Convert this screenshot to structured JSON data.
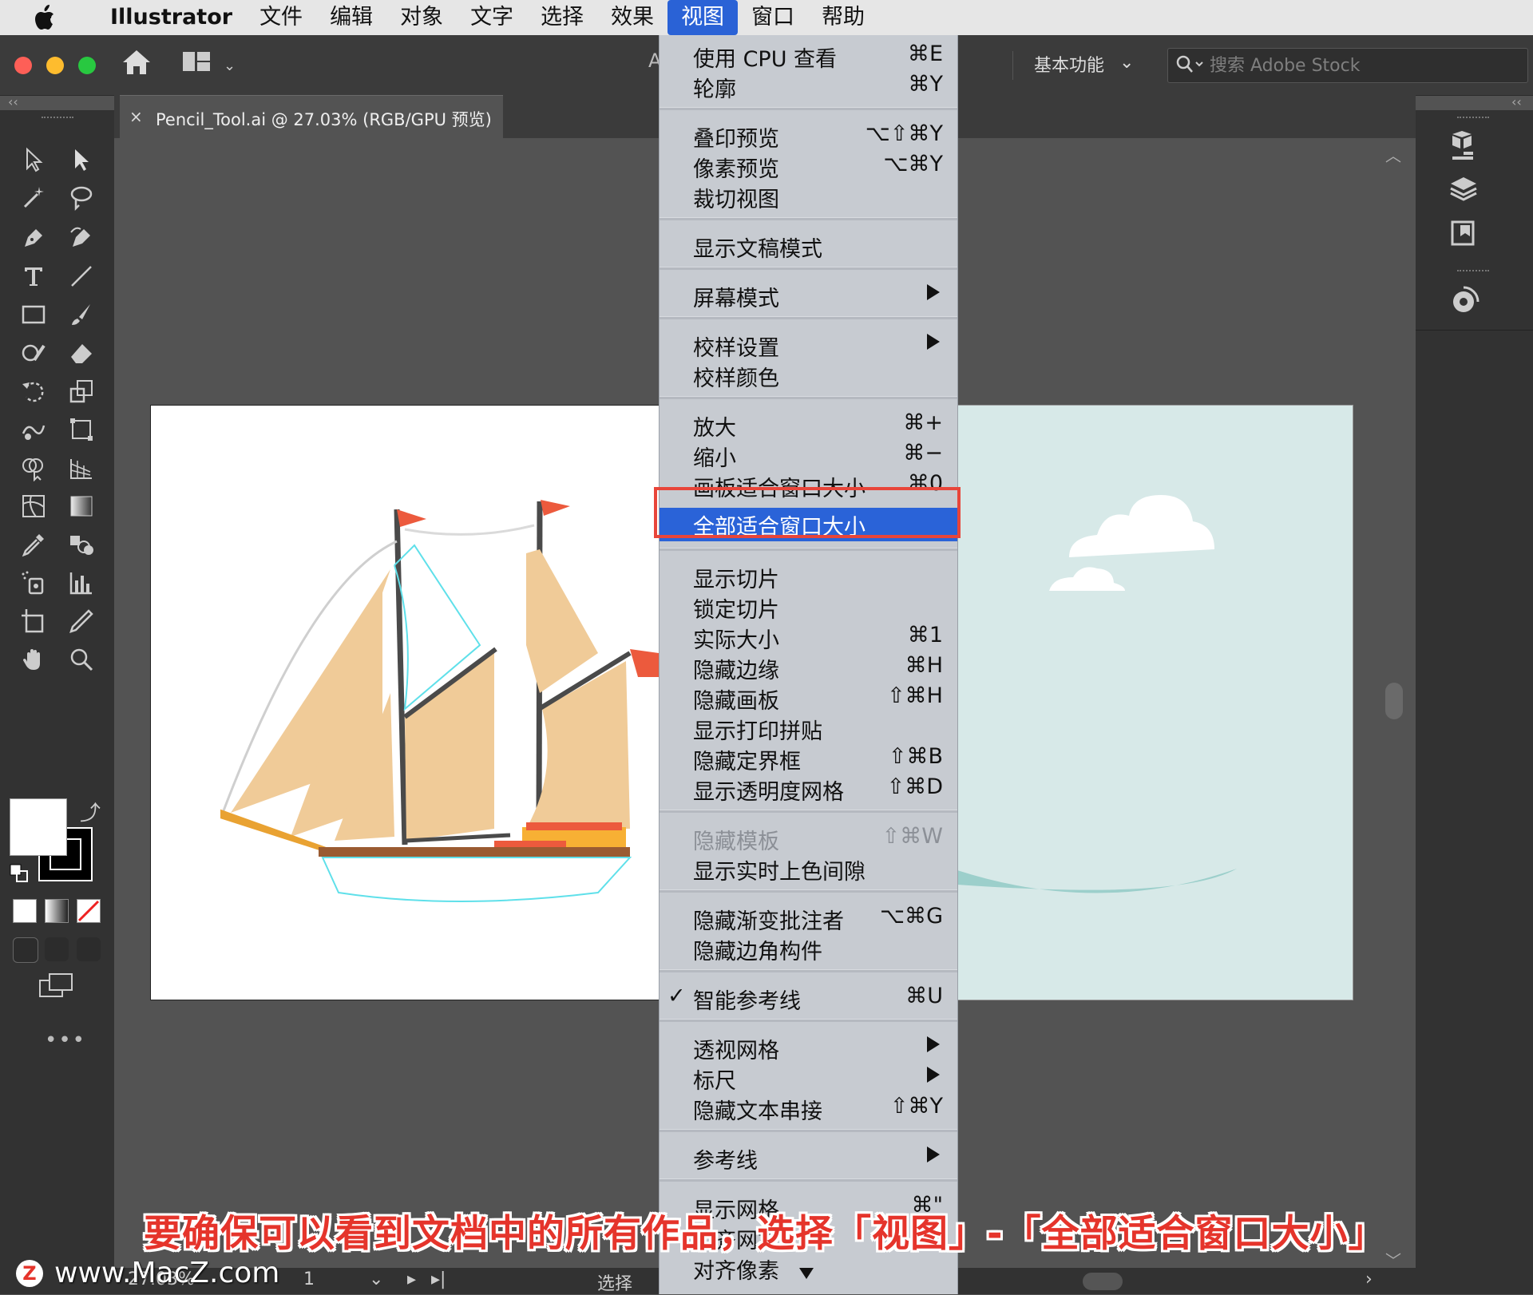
{
  "menubar": {
    "app": "Illustrator",
    "items": [
      "文件",
      "编辑",
      "对象",
      "文字",
      "选择",
      "效果",
      "视图",
      "窗口",
      "帮助"
    ],
    "active_index": 6
  },
  "appbar": {
    "center_letter": "A",
    "workspace": "基本功能",
    "search_placeholder": "搜索 Adobe Stock"
  },
  "document_tab": {
    "close": "×",
    "title": "Pencil_Tool.ai @ 27.03% (RGB/GPU 预览)"
  },
  "view_menu": [
    {
      "label": "使用 CPU 查看",
      "shortcut": "⌘E"
    },
    {
      "label": "轮廓",
      "shortcut": "⌘Y"
    },
    {
      "sep": true
    },
    {
      "label": "叠印预览",
      "shortcut": "⌥⇧⌘Y"
    },
    {
      "label": "像素预览",
      "shortcut": "⌥⌘Y"
    },
    {
      "label": "裁切视图",
      "shortcut": ""
    },
    {
      "sep": true
    },
    {
      "label": "显示文稿模式",
      "shortcut": ""
    },
    {
      "sep": true
    },
    {
      "label": "屏幕模式",
      "submenu": true
    },
    {
      "sep": true
    },
    {
      "label": "校样设置",
      "submenu": true
    },
    {
      "label": "校样颜色",
      "shortcut": ""
    },
    {
      "sep": true
    },
    {
      "label": "放大",
      "shortcut": "⌘+"
    },
    {
      "label": "缩小",
      "shortcut": "⌘−"
    },
    {
      "label": "画板适合窗口大小",
      "shortcut": "⌘0"
    },
    {
      "label": "全部适合窗口大小",
      "shortcut": "",
      "highlighted": true
    },
    {
      "sep": true
    },
    {
      "label": "显示切片",
      "shortcut": ""
    },
    {
      "label": "锁定切片",
      "shortcut": ""
    },
    {
      "label": "实际大小",
      "shortcut": "⌘1"
    },
    {
      "label": "隐藏边缘",
      "shortcut": "⌘H"
    },
    {
      "label": "隐藏画板",
      "shortcut": "⇧⌘H"
    },
    {
      "label": "显示打印拼贴",
      "shortcut": ""
    },
    {
      "label": "隐藏定界框",
      "shortcut": "⇧⌘B"
    },
    {
      "label": "显示透明度网格",
      "shortcut": "⇧⌘D"
    },
    {
      "sep": true
    },
    {
      "label": "隐藏模板",
      "shortcut": "⇧⌘W",
      "disabled": true
    },
    {
      "label": "显示实时上色间隙",
      "shortcut": ""
    },
    {
      "sep": true
    },
    {
      "label": "隐藏渐变批注者",
      "shortcut": "⌥⌘G"
    },
    {
      "label": "隐藏边角构件",
      "shortcut": ""
    },
    {
      "sep": true
    },
    {
      "label": "智能参考线",
      "shortcut": "⌘U",
      "checked": true
    },
    {
      "sep": true
    },
    {
      "label": "透视网格",
      "submenu": true
    },
    {
      "label": "标尺",
      "submenu": true
    },
    {
      "label": "隐藏文本串接",
      "shortcut": "⇧⌘Y"
    },
    {
      "sep": true
    },
    {
      "label": "参考线",
      "submenu": true
    },
    {
      "sep": true
    },
    {
      "label": "显示网格",
      "shortcut": "⌘\""
    },
    {
      "label": "对齐网格",
      "shortcut": ""
    },
    {
      "label": "对齐像素",
      "shortcut": ""
    }
  ],
  "status": {
    "zoom": "27.03%",
    "artboard": "1",
    "tool": "选择"
  },
  "caption": "要确保可以看到文档中的所有作品，选择「视图」-「全部适合窗口大小」",
  "watermark": {
    "logo": "Z",
    "text": "www.MacZ.com"
  },
  "colors": {
    "menu_highlight": "#2a63d8",
    "callout_border": "#e8453a",
    "caption_text": "#e5342b",
    "sail": "#f0cb98",
    "flag": "#ec5a3d"
  },
  "icons": [
    "apple-icon",
    "home-icon",
    "layout-icon",
    "search-icon",
    "selection-tool-icon",
    "direct-selection-tool-icon",
    "magic-wand-icon",
    "lasso-icon",
    "pen-icon",
    "curvature-icon",
    "type-icon",
    "line-icon",
    "rectangle-icon",
    "paintbrush-icon",
    "shaper-icon",
    "eraser-icon",
    "rotate-icon",
    "scale-icon",
    "warp-icon",
    "free-transform-icon",
    "shape-builder-icon",
    "perspective-icon",
    "mesh-icon",
    "gradient-icon",
    "eyedropper-icon",
    "blend-icon",
    "symbol-sprayer-icon",
    "graph-icon",
    "artboard-icon",
    "slice-icon",
    "hand-icon",
    "zoom-icon",
    "properties-icon",
    "layers-icon",
    "libraries-icon",
    "color-themes-icon"
  ]
}
